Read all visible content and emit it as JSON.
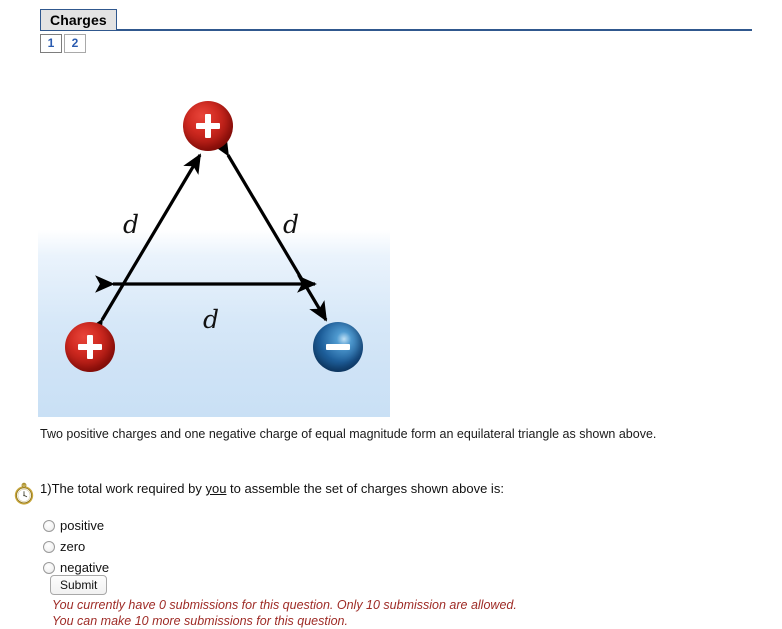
{
  "header": {
    "tab_label": "Charges",
    "pages": [
      {
        "label": "1",
        "active": true
      },
      {
        "label": "2",
        "active": false
      }
    ]
  },
  "figure": {
    "alt": "equilateral-triangle-of-charges",
    "charges": [
      {
        "id": "top",
        "sign": "+",
        "polarity": "positive",
        "color": "#c42a20"
      },
      {
        "id": "bottom-left",
        "sign": "+",
        "polarity": "positive",
        "color": "#c42a20"
      },
      {
        "id": "bottom-right",
        "sign": "−",
        "polarity": "negative",
        "color": "#1a5a92"
      }
    ],
    "distance_labels": [
      {
        "id": "left-side",
        "label": "d"
      },
      {
        "id": "right-side",
        "label": "d"
      },
      {
        "id": "bottom-side",
        "label": "d"
      }
    ],
    "background_color": "#cfe3f6",
    "caption": "Two positive charges and one negative charge of equal magnitude form an equilateral triangle as shown above."
  },
  "question": {
    "icon": "stopwatch-icon",
    "number": "1)",
    "prompt_before": "The total work required by ",
    "prompt_underlined": "you",
    "prompt_after": " to assemble the set of charges shown above is:",
    "options": [
      {
        "value": "positive",
        "label": "positive",
        "selected": false
      },
      {
        "value": "zero",
        "label": "zero",
        "selected": false
      },
      {
        "value": "negative",
        "label": "negative",
        "selected": false
      }
    ],
    "submit_label": "Submit",
    "notes": [
      "You currently have 0 submissions for this question. Only 10 submission are allowed.",
      "You can make 10 more submissions for this question."
    ],
    "notes_color": "#9e2b26"
  }
}
